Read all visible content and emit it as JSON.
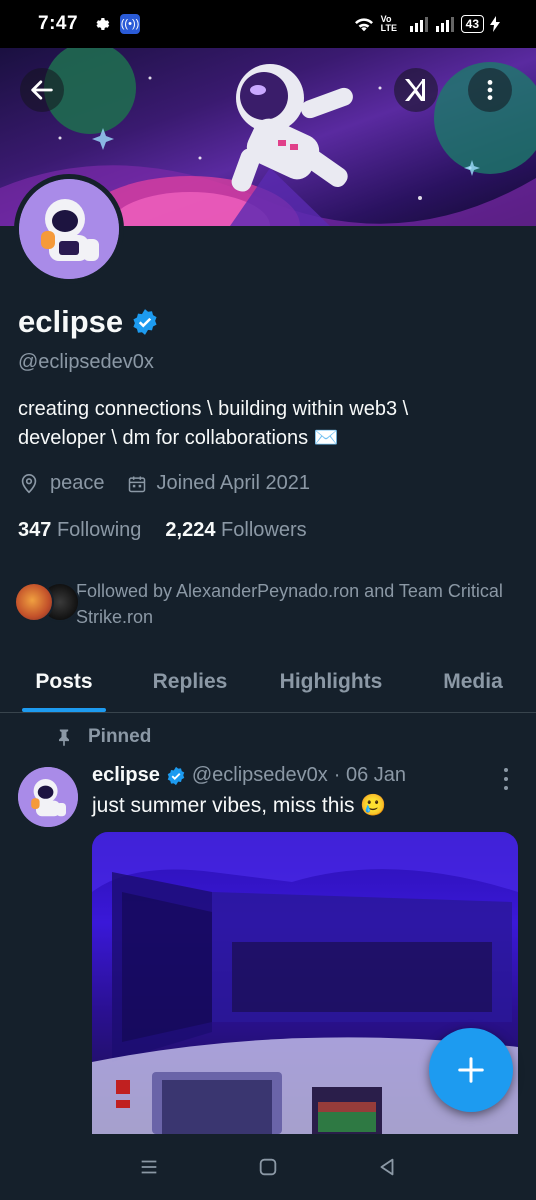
{
  "status_bar": {
    "time": "7:47",
    "network_label": "Vo LTE",
    "battery": "43"
  },
  "profile": {
    "name": "eclipse",
    "handle": "@eclipsedev0x",
    "bio_line1": "creating connections \\ building within web3 \\",
    "bio_line2": "developer \\ dm for collaborations ✉️",
    "location": "peace",
    "joined": "Joined April 2021",
    "following_count": "347",
    "following_label": "Following",
    "followers_count": "2,224",
    "followers_label": "Followers",
    "followed_by": "Followed by AlexanderPeynado.ron and Team Critical Strike.ron"
  },
  "tabs": [
    {
      "label": "Posts",
      "active": true
    },
    {
      "label": "Replies",
      "active": false
    },
    {
      "label": "Highlights",
      "active": false
    },
    {
      "label": "Media",
      "active": false
    }
  ],
  "pinned_post": {
    "pinned_label": "Pinned",
    "author_name": "eclipse",
    "author_handle": "@eclipsedev0x",
    "date": "· 06 Jan",
    "text": "just summer vibes, miss this 🥲"
  },
  "colors": {
    "accent": "#1d9bf0",
    "background": "#15202b",
    "muted": "#8b98a5"
  },
  "icons": {
    "back": "arrow-left-icon",
    "grok": "grok-icon",
    "more": "more-vertical-icon",
    "verified": "verified-badge-icon",
    "location": "location-pin-icon",
    "calendar": "calendar-icon",
    "pin": "pin-icon",
    "compose": "plus-icon"
  }
}
